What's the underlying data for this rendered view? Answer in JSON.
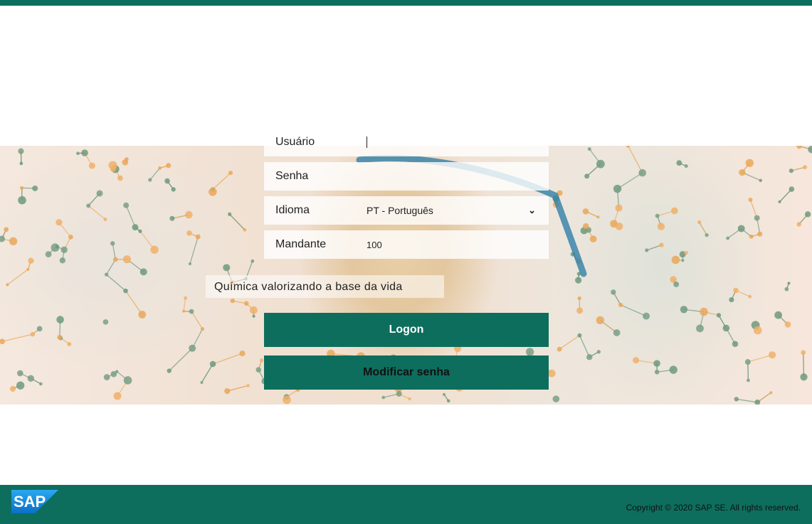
{
  "form": {
    "username_label": "Usuário",
    "username_value": "",
    "password_label": "Senha",
    "password_value": "",
    "language_label": "Idioma",
    "language_selected": "PT - Português",
    "client_label": "Mandante",
    "client_value": "100"
  },
  "tagline": "Química valorizando a base da vida",
  "buttons": {
    "logon": "Logon",
    "change_password": "Modificar senha"
  },
  "footer": {
    "logo_text": "SAP",
    "copyright": "Copyright © 2020 SAP SE. All rights reserved."
  },
  "colors": {
    "brand": "#0d6e5e",
    "sap_blue": "#1a7fd0"
  },
  "icons": {
    "select": "chevron-down-icon",
    "logo": "sap-logo-icon"
  }
}
